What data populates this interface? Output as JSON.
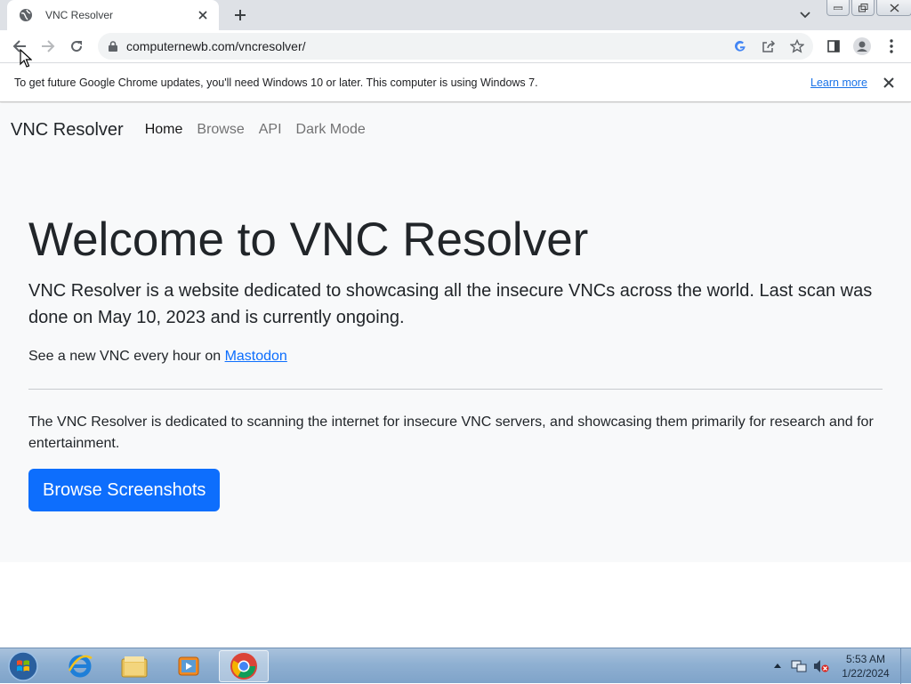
{
  "browser": {
    "tab_title": "VNC Resolver",
    "url": "computernewb.com/vncresolver/",
    "infobar_text": "To get future Google Chrome updates, you'll need Windows 10 or later. This computer is using Windows 7.",
    "infobar_link": "Learn more"
  },
  "site": {
    "brand": "VNC Resolver",
    "nav": [
      "Home",
      "Browse",
      "API",
      "Dark Mode"
    ],
    "heading": "Welcome to VNC Resolver",
    "lead": "VNC Resolver is a website dedicated to showcasing all the insecure VNCs across the world. Last scan was done on May 10, 2023 and is currently ongoing.",
    "mastodon_prefix": "See a new VNC every hour on ",
    "mastodon_link": "Mastodon",
    "description": "The VNC Resolver is dedicated to scanning the internet for insecure VNC servers, and showcasing them primarily for research and for entertainment.",
    "cta_label": "Browse Screenshots"
  },
  "taskbar": {
    "time": "5:53 AM",
    "date": "1/22/2024",
    "apps": [
      "internet-explorer",
      "windows-explorer",
      "media-player",
      "google-chrome"
    ]
  },
  "colors": {
    "link": "#0d6efd",
    "button": "#0d6efd",
    "chrome_link": "#1a73e8"
  }
}
